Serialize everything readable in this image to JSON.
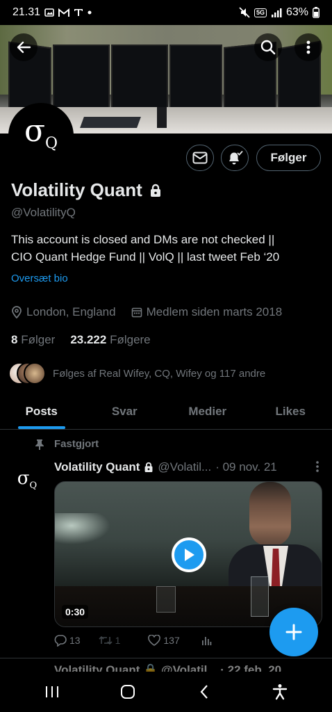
{
  "status_bar": {
    "time": "21.31",
    "battery": "63%",
    "network": "5G"
  },
  "banner": {
    "back_icon": "arrow-left-icon",
    "search_icon": "search-icon",
    "more_icon": "more-vertical-icon"
  },
  "profile": {
    "avatar_text": "σ",
    "avatar_sub": "Q",
    "display_name": "Volatility Quant",
    "handle": "@VolatilityQ",
    "bio_line1": "This account is closed and DMs are not checked ||",
    "bio_line2": "CIO Quant Hedge Fund || VolQ || last tweet Feb ‘20",
    "translate_label": "Oversæt bio",
    "location": "London, England",
    "joined": "Medlem siden marts 2018",
    "following_count": "8",
    "following_label": "Følger",
    "followers_count": "23.222",
    "followers_label": "Følgere",
    "followed_by": "Følges af Real Wifey, CQ, Wifey og 117 andre",
    "follow_button": "Følger"
  },
  "tabs": [
    {
      "label": "Posts",
      "active": true
    },
    {
      "label": "Svar",
      "active": false
    },
    {
      "label": "Medier",
      "active": false
    },
    {
      "label": "Likes",
      "active": false
    }
  ],
  "pinned_tweet": {
    "pinned_label": "Fastgjort",
    "name": "Volatility Quant",
    "handle": "@Volatil...",
    "date": "· 09 nov. 21",
    "duration": "0:30",
    "replies": "13",
    "retweets": "1",
    "likes": "137"
  },
  "next_tweet": {
    "partial_text": "Volatility Quant 🔒 @Volatil... · 22 feb. 20"
  },
  "colors": {
    "accent": "#1d9bf0",
    "muted": "#71767b",
    "text": "#e7e9ea",
    "border": "#2f3336"
  }
}
